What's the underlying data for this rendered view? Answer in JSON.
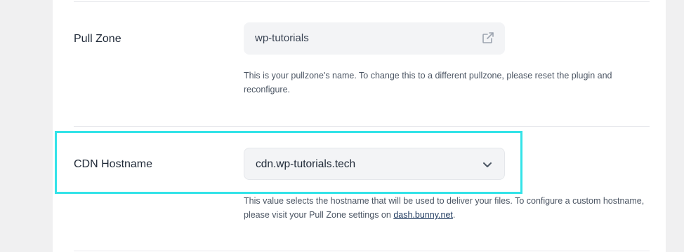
{
  "pull_zone": {
    "label": "Pull Zone",
    "value": "wp-tutorials",
    "icon": "external-link-icon",
    "help": "This is your pullzone's name. To change this to a different pullzone, please reset the plugin and reconfigure."
  },
  "cdn_hostname": {
    "label": "CDN Hostname",
    "selected": "cdn.wp-tutorials.tech",
    "icon": "chevron-down-icon",
    "help_before": "This value selects the hostname that will be used to deliver your files. To configure a custom hostname, please visit your Pull Zone settings on ",
    "help_link": "dash.bunny.net",
    "help_after": "."
  },
  "colors": {
    "highlight": "#33e3e8",
    "field_bg": "#f3f4f6",
    "link": "#1f3a5f"
  }
}
